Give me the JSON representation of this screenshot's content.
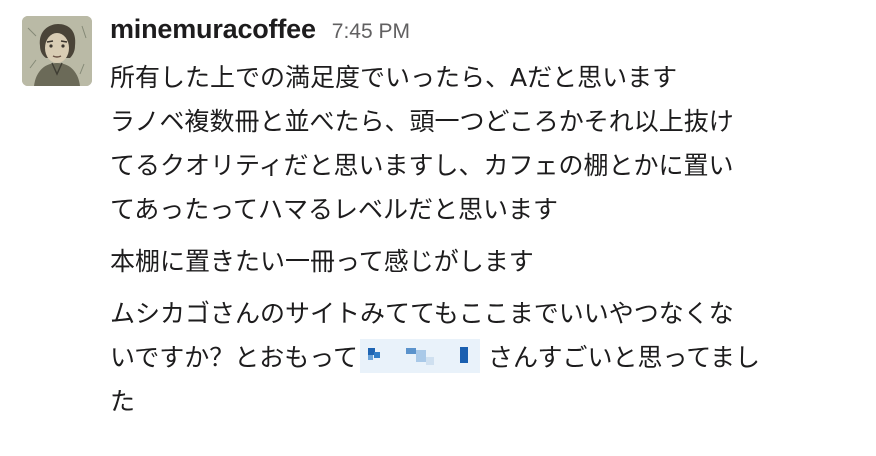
{
  "message": {
    "username": "minemuracoffee",
    "timestamp": "7:45 PM",
    "avatar_icon": "user-avatar-icon",
    "paragraphs": [
      {
        "lines": [
          "所有した上での満足度でいったら、Aだと思います",
          "ラノベ複数冊と並べたら、頭一つどころかそれ以上抜け",
          "てるクオリティだと思いますし、カフェの棚とかに置い",
          "てあったってハマるレベルだと思います"
        ]
      },
      {
        "lines": [
          "本棚に置きたい一冊って感じがします"
        ]
      },
      {
        "lines": [
          "ムシカゴさんのサイトみててもここまでいいやつなくな"
        ],
        "line_with_redaction": {
          "before": "いですか？とおもって",
          "after": "さんすごいと思ってまし"
        },
        "last_line": "た"
      }
    ]
  }
}
